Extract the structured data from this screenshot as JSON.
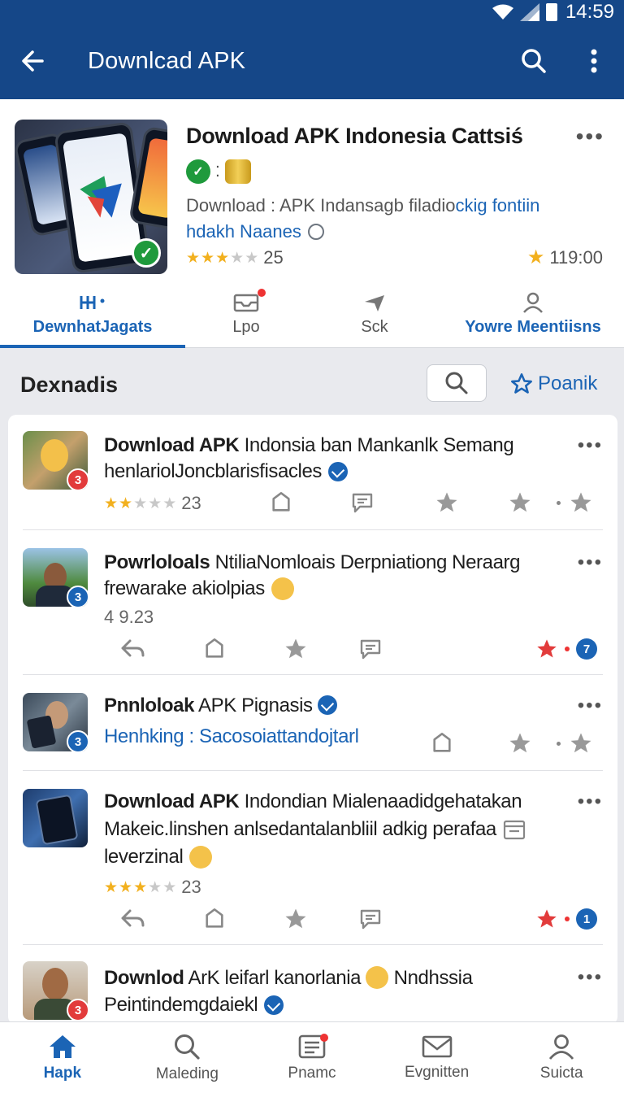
{
  "status_bar": {
    "time": "14:59"
  },
  "toolbar": {
    "title": "Downlcad APK"
  },
  "app": {
    "title": "Download APK Indonesia Cattsiś",
    "desc_plain": "Download : APK Indansagb filadio",
    "desc_accent": "ckig fontiin",
    "sub": "hdakh Naanes",
    "rating_count": "25",
    "stars": 2.5,
    "score": "119:00"
  },
  "tabs": [
    {
      "label": "DewnhatJagats",
      "active": true,
      "icon": "grid-icon"
    },
    {
      "label": "Lpo",
      "active": false,
      "icon": "inbox-icon"
    },
    {
      "label": "Sck",
      "active": false,
      "icon": "send-icon"
    },
    {
      "label": "Yowre Meentiisns",
      "active": false,
      "icon": "person-icon"
    }
  ],
  "section": {
    "title": "Dexnadis",
    "rank_label": "Poanik"
  },
  "items": [
    {
      "title_bold": "Download APK",
      "title_rest": " Indonsia ban Mankanlk Semang",
      "sub": "henlariolJoncblarisfisacles",
      "rating": "23",
      "badge": "3",
      "badge_color": "#e23b3b"
    },
    {
      "title_bold": "Powrloloals",
      "title_rest": " NtiliaNomloais Derpniationg Neraarg",
      "sub": "frewarake akiolpias",
      "rating": "4 9.23",
      "badge": "3",
      "count": "7",
      "badge_color": "#1b64b5"
    },
    {
      "title_bold": "Pnnloloak",
      "title_rest": " APK Pignasis",
      "sub": "Henhking : Sacosoiattandojtarl",
      "badge": "3",
      "badge_color": "#1b64b5"
    },
    {
      "title_bold": "Download APK",
      "title_rest": " Indondian Mialenaadidgehatakan",
      "sub": "Makeic.linshen anlsedantalanbliil adkig perafaa",
      "sub2": "leverzinal",
      "rating": "23",
      "count": "1",
      "badge_color": "#1b64b5"
    },
    {
      "title_bold": "Downlod",
      "title_rest": " ArK leifarl kanorlania",
      "title_tail": "Nndhssia",
      "sub": "Peintindemgdaiekl",
      "badge": "3",
      "badge_color": "#e23b3b"
    }
  ],
  "bottom_nav": [
    {
      "label": "Hapk",
      "active": true,
      "icon": "home-icon"
    },
    {
      "label": "Maleding",
      "active": false,
      "icon": "search-icon"
    },
    {
      "label": "Pnamc",
      "active": false,
      "icon": "list-icon"
    },
    {
      "label": "Evgnitten",
      "active": false,
      "icon": "mail-icon"
    },
    {
      "label": "Suicta",
      "active": false,
      "icon": "person-icon"
    }
  ]
}
